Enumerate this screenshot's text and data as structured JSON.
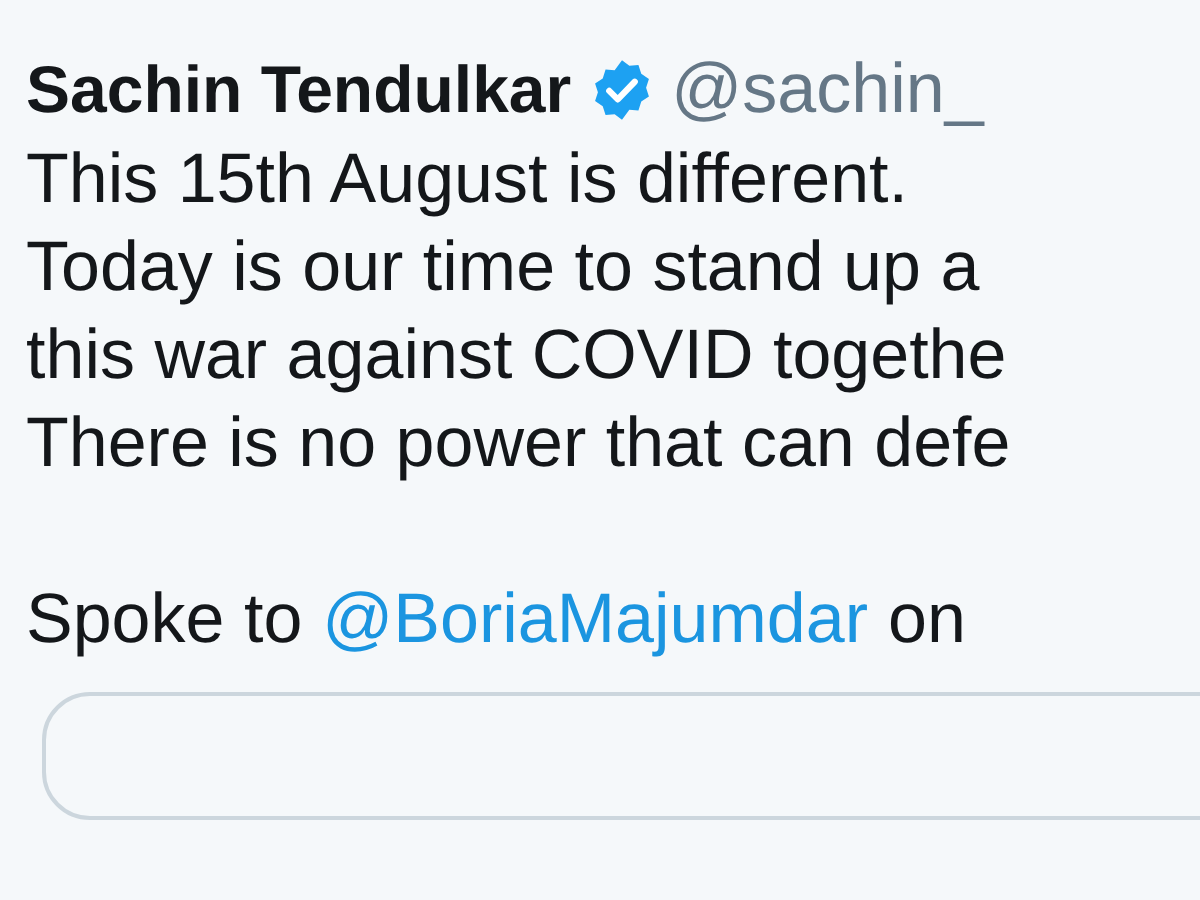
{
  "tweet": {
    "author": {
      "name": "Sachin Tendulkar",
      "verified": true,
      "handle": "@sachin_"
    },
    "lines": [
      "This 15th August is different.",
      "Today is our time to stand up a",
      "this war against COVID togethe",
      "There is no power that can defe"
    ],
    "closing": {
      "text": "Spoke to",
      "mention": "@BoriaMajumdar",
      "after": "on"
    },
    "card": {
      "kind": "quoted"
    }
  }
}
